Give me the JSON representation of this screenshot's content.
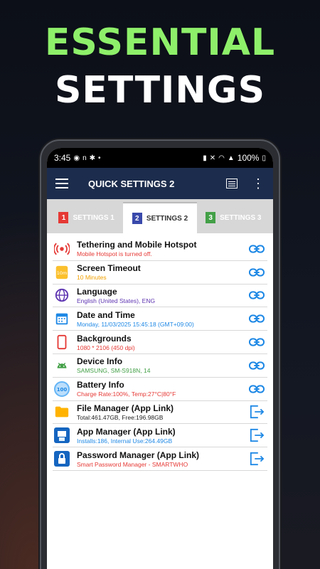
{
  "headline": {
    "line1": "ESSENTIAL",
    "line2": "SETTINGS"
  },
  "status": {
    "time": "3:45",
    "battery": "100%"
  },
  "appbar": {
    "title": "QUICK SETTINGS 2"
  },
  "tabs": [
    {
      "num": "1",
      "label": "SETTINGS 1",
      "color": "#e53935"
    },
    {
      "num": "2",
      "label": "SETTINGS 2",
      "color": "#3949ab"
    },
    {
      "num": "3",
      "label": "SETTINGS 3",
      "color": "#43a047"
    }
  ],
  "items": [
    {
      "title": "Tethering and Mobile Hotspot",
      "sub": "Mobile Hotspot is turned off.",
      "subColor": "#e53935",
      "icon": "hotspot-icon",
      "action": "link-icon"
    },
    {
      "title": "Screen Timeout",
      "sub": "10 Minutes",
      "subColor": "#f2a100",
      "icon": "timeout-icon",
      "action": "link-icon"
    },
    {
      "title": "Language",
      "sub": "English (United States), ENG",
      "subColor": "#5e35b1",
      "icon": "globe-icon",
      "action": "link-icon"
    },
    {
      "title": "Date and Time",
      "sub": "Monday,  11/03/2025 15:45:18  (GMT+09:00)",
      "subColor": "#1e88e5",
      "icon": "calendar-icon",
      "action": "link-icon"
    },
    {
      "title": "Backgrounds",
      "sub": "1080 * 2106  (450 dpi)",
      "subColor": "#e53935",
      "icon": "phone-icon",
      "action": "link-icon"
    },
    {
      "title": "Device Info",
      "sub": "SAMSUNG, SM-S918N, 14",
      "subColor": "#43a047",
      "icon": "android-icon",
      "action": "link-icon"
    },
    {
      "title": "Battery Info",
      "sub": "Charge Rate:100%, Temp:27°C|80°F",
      "subColor": "#e53935",
      "icon": "battery-icon",
      "action": "link-icon"
    },
    {
      "title": "File Manager (App Link)",
      "sub": "Total:461.47GB, Free:196.98GB",
      "subColor": "#222222",
      "icon": "folder-icon",
      "action": "open-app-icon"
    },
    {
      "title": "App Manager (App Link)",
      "sub": "Installs:186, Internal Use:264.49GB",
      "subColor": "#1e88e5",
      "icon": "app-manager-icon",
      "action": "open-app-icon"
    },
    {
      "title": "Password Manager (App Link)",
      "sub": "Smart Password Manager - SMARTWHO",
      "subColor": "#e53935",
      "icon": "lock-icon",
      "action": "open-app-icon"
    }
  ]
}
